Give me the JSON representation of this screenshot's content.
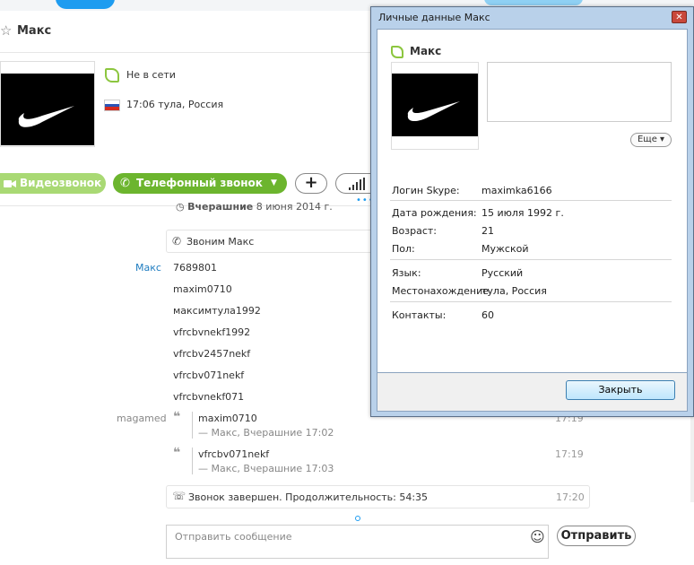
{
  "contact": {
    "name": "Макс",
    "status": "Не в сети",
    "location_time": "17:06 тула, Россия"
  },
  "actions": {
    "video_call": "Видеозвонок",
    "phone_call": "Телефонный звонок",
    "add_icon": "+"
  },
  "chat": {
    "date_label_bold": "Вчерашние",
    "date_label_rest": " 8 июня 2014 г.",
    "call_event": "Звоним Макс",
    "sender1": "Макс",
    "messages": [
      "7689801",
      "maxim0710",
      "максимтула1992",
      "vfrcbvnekf1992",
      "vfrcbv2457nekf",
      "vfrcbv071nekf",
      "vfrcbvnekf071"
    ],
    "sender2": "magamed",
    "quotes": [
      {
        "text": "maxim0710",
        "sub": "— Макс, Вчерашние 17:02",
        "time": "17:19"
      },
      {
        "text": "vfrcbv071nekf",
        "sub": "— Макс, Вчерашние 17:03",
        "time": "17:19"
      }
    ],
    "call_ended": "Звонок завершен. Продолжительность: 54:35",
    "call_ended_time": "17:20"
  },
  "composer": {
    "placeholder": "Отправить сообщение",
    "send_label": "Отправить"
  },
  "dialog": {
    "title": "Личные данные Макс",
    "name": "Макс",
    "more": "Еще ▾",
    "fields": [
      {
        "label": "Логин Skype:",
        "value": "maximka6166"
      },
      {
        "label": "Дата рождения:",
        "value": "15 июля 1992 г."
      },
      {
        "label": "Возраст:",
        "value": "21"
      },
      {
        "label": "Пол:",
        "value": "Мужской"
      },
      {
        "label": "Язык:",
        "value": "Русский"
      },
      {
        "label": "Местонахождение",
        "value": "тула, Россия"
      },
      {
        "label": "Контакты:",
        "value": "60"
      }
    ],
    "close_label": "Закрыть"
  },
  "colors": {
    "accent_green": "#6cb52e",
    "light_green": "#a9d974",
    "skype_blue": "#1e9cf0"
  }
}
